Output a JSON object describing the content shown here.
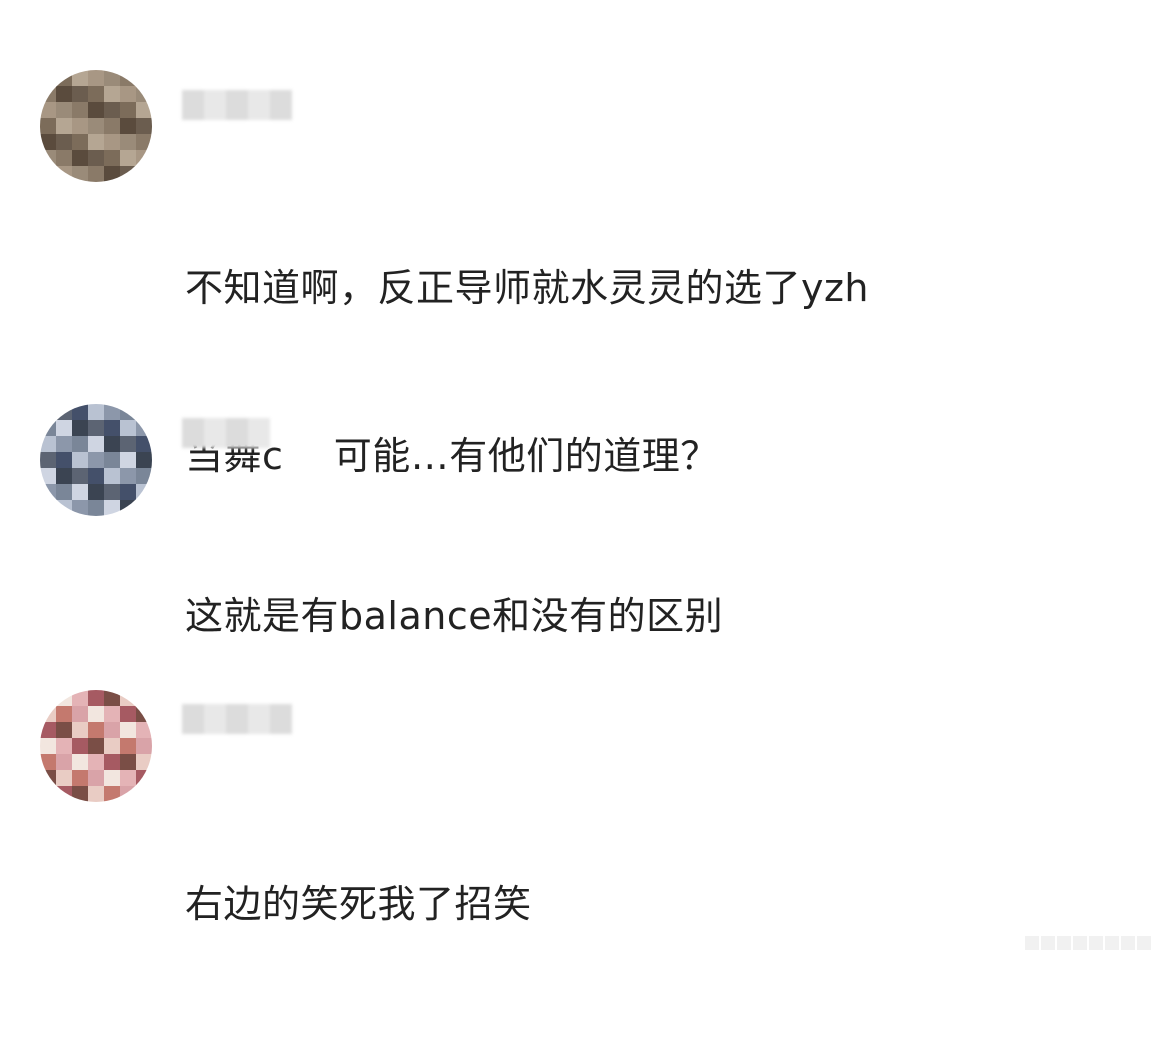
{
  "comments": [
    {
      "lines": [
        "不知道啊，反正导师就水灵灵的选了yzh",
        "当舞c    可能…有他们的道理？"
      ],
      "avatar_colors": [
        "#6b5d4f",
        "#8a7a68",
        "#a89784",
        "#7c6c5a",
        "#5a4b3d",
        "#9a8b79",
        "#b5a693"
      ]
    },
    {
      "lines": [
        "这就是有balance和没有的区别"
      ],
      "avatar_colors": [
        "#3b4452",
        "#7a8698",
        "#b9c2d2",
        "#5c6473",
        "#cfd5e2",
        "#8c97aa",
        "#44506a"
      ]
    },
    {
      "lines": [
        "右边的笑死我了招笑"
      ],
      "avatar_colors": [
        "#d9a3a8",
        "#e9ccc4",
        "#a65a62",
        "#f2e6df",
        "#c4796e",
        "#7a4e46",
        "#e4b3b6"
      ]
    }
  ]
}
